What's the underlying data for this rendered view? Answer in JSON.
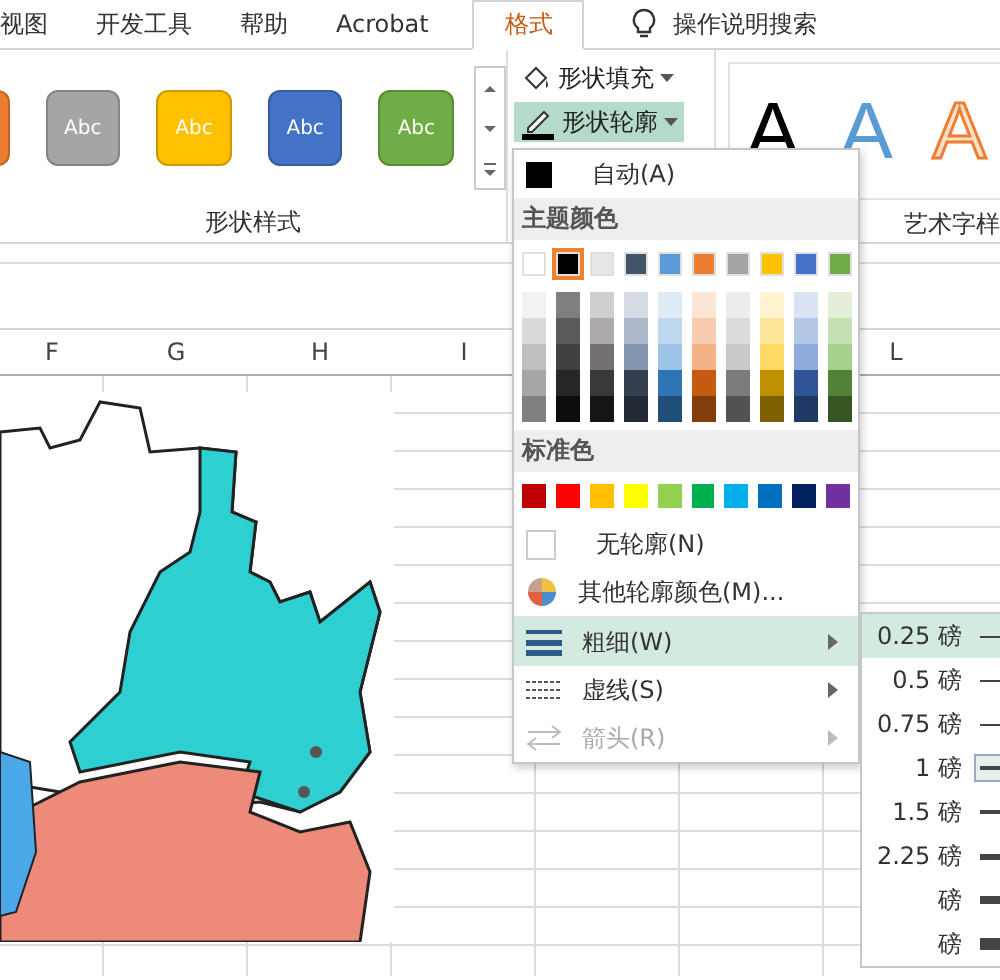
{
  "tabs": [
    {
      "label": "视图",
      "selected": false
    },
    {
      "label": "开发工具",
      "selected": false
    },
    {
      "label": "帮助",
      "selected": false
    },
    {
      "label": "Acrobat",
      "selected": false
    },
    {
      "label": "格式",
      "selected": true
    }
  ],
  "search": {
    "label": "操作说明搜索"
  },
  "shape_styles": {
    "label": "形状样式",
    "items": [
      {
        "color": "#ed7d31"
      },
      {
        "label": "Abc",
        "color": "#a5a5a5"
      },
      {
        "label": "Abc",
        "color": "#ffc000"
      },
      {
        "label": "Abc",
        "color": "#4472c4"
      },
      {
        "label": "Abc",
        "color": "#70ad47"
      }
    ]
  },
  "shape_commands": [
    {
      "label": "形状填充",
      "kind": "fill",
      "selected": false
    },
    {
      "label": "形状轮廓",
      "kind": "outline",
      "selected": true
    }
  ],
  "wordart": {
    "label": "艺术字样",
    "samples": [
      {
        "label": "A",
        "kind": "solid"
      },
      {
        "label": "A",
        "kind": "light"
      },
      {
        "label": "A",
        "kind": "outline"
      }
    ]
  },
  "column_headers": [
    "F",
    "G",
    "H",
    "I",
    "L"
  ],
  "menu": {
    "automatic": {
      "label": "自动(A)"
    },
    "theme_title": "主题颜色",
    "theme_colors": [
      {
        "color": "#ffffff",
        "selected": false,
        "shades": [
          {
            "color": "#f2f2f2"
          },
          {
            "color": "#d9d9d9"
          },
          {
            "color": "#bfbfbf"
          },
          {
            "color": "#a6a6a6"
          },
          {
            "color": "#808080"
          }
        ]
      },
      {
        "color": "#000000",
        "selected": true,
        "shades": [
          {
            "color": "#7f7f7f"
          },
          {
            "color": "#595959"
          },
          {
            "color": "#404040"
          },
          {
            "color": "#262626"
          },
          {
            "color": "#0d0d0d"
          }
        ]
      },
      {
        "color": "#e7e6e6",
        "selected": false,
        "shades": [
          {
            "color": "#d0cece"
          },
          {
            "color": "#aeaaaa"
          },
          {
            "color": "#757171"
          },
          {
            "color": "#3a3838"
          },
          {
            "color": "#171616"
          }
        ]
      },
      {
        "color": "#44546a",
        "selected": false,
        "shades": [
          {
            "color": "#d6dce4"
          },
          {
            "color": "#adb9ca"
          },
          {
            "color": "#8497b0"
          },
          {
            "color": "#333f4f"
          },
          {
            "color": "#222a35"
          }
        ]
      },
      {
        "color": "#5b9bd5",
        "selected": false,
        "shades": [
          {
            "color": "#deebf6"
          },
          {
            "color": "#bdd7ee"
          },
          {
            "color": "#9dc3e6"
          },
          {
            "color": "#2e75b5"
          },
          {
            "color": "#1f4e79"
          }
        ]
      },
      {
        "color": "#ed7d31",
        "selected": false,
        "shades": [
          {
            "color": "#fbe5d5"
          },
          {
            "color": "#f7cbac"
          },
          {
            "color": "#f4b183"
          },
          {
            "color": "#c55a11"
          },
          {
            "color": "#833c0b"
          }
        ]
      },
      {
        "color": "#a5a5a5",
        "selected": false,
        "shades": [
          {
            "color": "#ededed"
          },
          {
            "color": "#dbdbdb"
          },
          {
            "color": "#c9c9c9"
          },
          {
            "color": "#7b7b7b"
          },
          {
            "color": "#525252"
          }
        ]
      },
      {
        "color": "#ffc000",
        "selected": false,
        "shades": [
          {
            "color": "#fff2cc"
          },
          {
            "color": "#fee599"
          },
          {
            "color": "#ffd965"
          },
          {
            "color": "#bf9000"
          },
          {
            "color": "#7f6000"
          }
        ]
      },
      {
        "color": "#4472c4",
        "selected": false,
        "shades": [
          {
            "color": "#dae3f3"
          },
          {
            "color": "#b4c7e7"
          },
          {
            "color": "#8faadc"
          },
          {
            "color": "#2f5597"
          },
          {
            "color": "#203864"
          }
        ]
      },
      {
        "color": "#70ad47",
        "selected": false,
        "shades": [
          {
            "color": "#e2efd9"
          },
          {
            "color": "#c5e0b3"
          },
          {
            "color": "#a8d08d"
          },
          {
            "color": "#538135"
          },
          {
            "color": "#375623"
          }
        ]
      }
    ],
    "standard_title": "标准色",
    "standard_colors": [
      {
        "color": "#c00000"
      },
      {
        "color": "#ff0000"
      },
      {
        "color": "#ffc000"
      },
      {
        "color": "#ffff00"
      },
      {
        "color": "#92d050"
      },
      {
        "color": "#00b050"
      },
      {
        "color": "#00b0f0"
      },
      {
        "color": "#0070c0"
      },
      {
        "color": "#002060"
      },
      {
        "color": "#7030a0"
      }
    ],
    "no_outline": {
      "label": "无轮廓(N)"
    },
    "more_colors": {
      "label": "其他轮廓颜色(M)..."
    },
    "submenus": [
      {
        "label": "粗细(W)",
        "kind": "weight",
        "selected": true,
        "disabled": false
      },
      {
        "label": "虚线(S)",
        "kind": "dash",
        "selected": false,
        "disabled": false
      },
      {
        "label": "箭头(R)",
        "kind": "arrow",
        "selected": false,
        "disabled": true
      }
    ]
  },
  "weights": [
    {
      "label": "0.25 磅",
      "selected": true,
      "current": false
    },
    {
      "label": "0.5 磅",
      "selected": false,
      "current": false
    },
    {
      "label": "0.75 磅",
      "selected": false,
      "current": false
    },
    {
      "label": "1 磅",
      "selected": false,
      "current": true
    },
    {
      "label": "1.5 磅",
      "selected": false,
      "current": false
    },
    {
      "label": "2.25 磅",
      "selected": false,
      "current": false
    },
    {
      "label": "磅",
      "selected": false,
      "current": false
    },
    {
      "label": "磅",
      "selected": false,
      "current": false
    }
  ]
}
